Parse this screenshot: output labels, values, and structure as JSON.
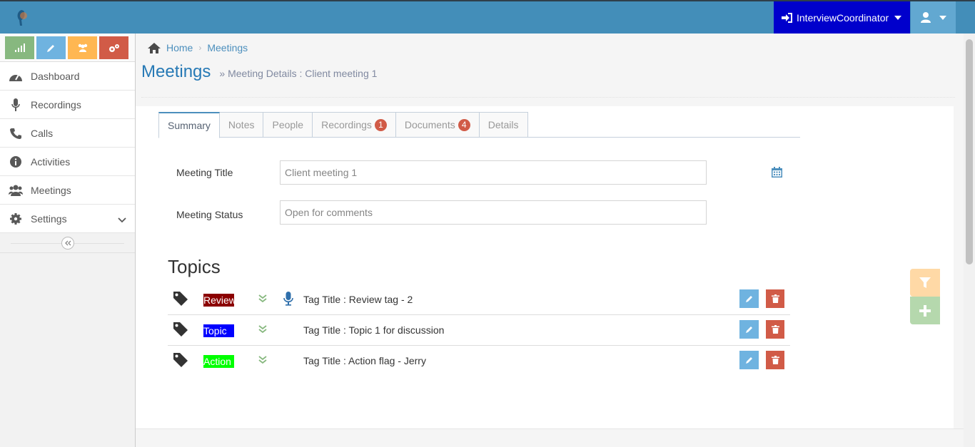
{
  "navbar": {
    "user_login_label": "InterviewCoordinator",
    "colors": {
      "navbar": "#438eb9",
      "user_login_bg": "#0000cc",
      "user_menu_bg": "#62a8d1"
    }
  },
  "sidebar": {
    "shortcuts": [
      {
        "icon": "signal-icon",
        "color": "#87b87f"
      },
      {
        "icon": "pencil-icon",
        "color": "#6fb3e0"
      },
      {
        "icon": "users-icon",
        "color": "#ffb752"
      },
      {
        "icon": "cogs-icon",
        "color": "#d15b47"
      }
    ],
    "items": [
      {
        "label": "Dashboard",
        "icon": "tachometer-icon"
      },
      {
        "label": "Recordings",
        "icon": "microphone-icon"
      },
      {
        "label": "Calls",
        "icon": "phone-icon"
      },
      {
        "label": "Activities",
        "icon": "info-circle-icon"
      },
      {
        "label": "Meetings",
        "icon": "users-icon"
      },
      {
        "label": "Settings",
        "icon": "gear-icon"
      }
    ]
  },
  "breadcrumb": {
    "home": "Home",
    "current": "Meetings"
  },
  "page": {
    "title": "Meetings",
    "subtitle": "Meeting Details : Client meeting 1"
  },
  "tabs": [
    {
      "label": "Summary",
      "active": true
    },
    {
      "label": "Notes"
    },
    {
      "label": "People"
    },
    {
      "label": "Recordings",
      "badge": "1"
    },
    {
      "label": "Documents",
      "badge": "4"
    },
    {
      "label": "Details"
    }
  ],
  "form": {
    "title_label": "Meeting Title",
    "title_value": "Client meeting 1",
    "status_label": "Meeting Status",
    "status_value": "Open for comments"
  },
  "topics": {
    "heading": "Topics",
    "rows": [
      {
        "tag": "Review",
        "tag_bg": "#8b0000",
        "title": "Tag Title : Review tag - 2",
        "has_recording": true
      },
      {
        "tag": "Topic",
        "tag_bg": "#0000ff",
        "title": "Tag Title : Topic 1 for discussion",
        "has_recording": false
      },
      {
        "tag": "Action",
        "tag_bg": "#00ff00",
        "title": "Tag Title : Action flag - Jerry",
        "has_recording": false
      }
    ]
  }
}
